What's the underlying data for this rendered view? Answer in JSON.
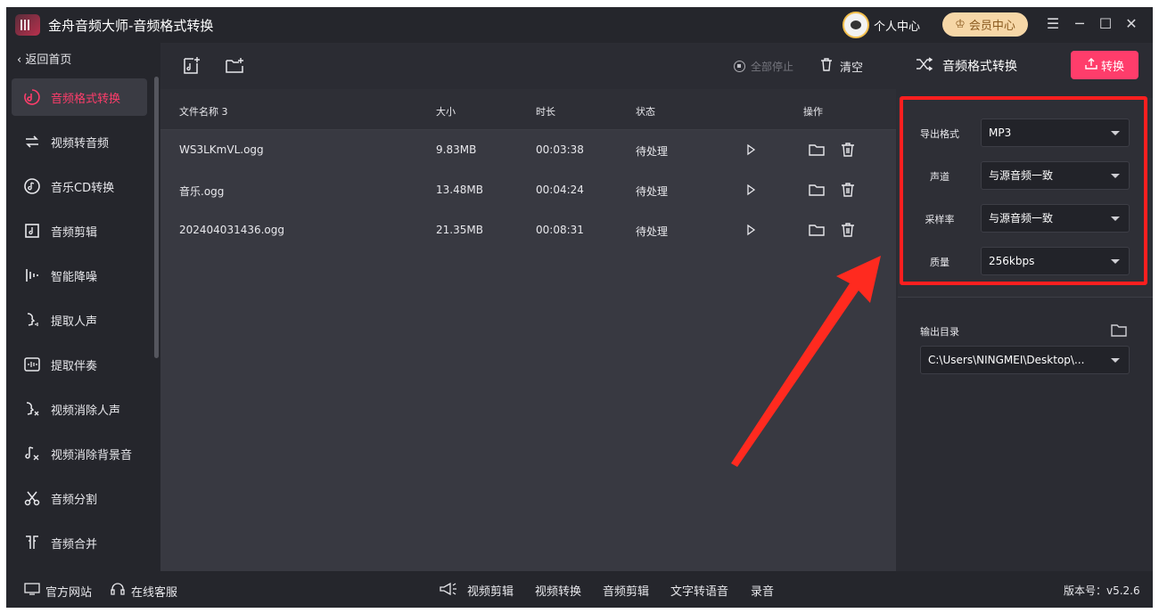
{
  "app": {
    "title": "金舟音频大师-音频格式转换",
    "user_center": "个人中心",
    "vip_center": "会员中心"
  },
  "sidebar": {
    "back": "返回首页",
    "items": [
      {
        "label": "音频格式转换",
        "icon": "audio-convert-icon",
        "active": true
      },
      {
        "label": "视频转音频",
        "icon": "video-to-audio-icon"
      },
      {
        "label": "音乐CD转换",
        "icon": "cd-icon"
      },
      {
        "label": "音频剪辑",
        "icon": "audio-cut-icon"
      },
      {
        "label": "智能降噪",
        "icon": "denoise-icon"
      },
      {
        "label": "提取人声",
        "icon": "vocal-icon"
      },
      {
        "label": "提取伴奏",
        "icon": "accompaniment-icon"
      },
      {
        "label": "视频消除人声",
        "icon": "remove-vocal-icon"
      },
      {
        "label": "视频消除背景音",
        "icon": "remove-bgm-icon"
      },
      {
        "label": "音频分割",
        "icon": "scissors-icon"
      },
      {
        "label": "音频合并",
        "icon": "merge-icon"
      }
    ]
  },
  "toolbar": {
    "stop_all": "全部停止",
    "clear": "清空"
  },
  "table": {
    "headers": {
      "name": "文件名称 3",
      "size": "大小",
      "duration": "时长",
      "status": "状态",
      "actions": "操作"
    },
    "rows": [
      {
        "name": "WS3LKmVL.ogg",
        "size": "9.83MB",
        "duration": "00:03:38",
        "status": "待处理"
      },
      {
        "name": "音乐.ogg",
        "size": "13.48MB",
        "duration": "00:04:24",
        "status": "待处理"
      },
      {
        "name": "202404031436.ogg",
        "size": "21.35MB",
        "duration": "00:08:31",
        "status": "待处理"
      }
    ]
  },
  "panel": {
    "title": "音频格式转换",
    "convert": "转换",
    "settings": [
      {
        "label": "导出格式",
        "value": "MP3"
      },
      {
        "label": "声道",
        "value": "与源音频一致"
      },
      {
        "label": "采样率",
        "value": "与源音频一致"
      },
      {
        "label": "质量",
        "value": "256kbps"
      }
    ],
    "output_label": "输出目录",
    "output_path": "C:\\Users\\NINGMEI\\Desktop\\..."
  },
  "bottom": {
    "website": "官方网站",
    "service": "在线客服",
    "links": [
      "视频剪辑",
      "视频转换",
      "音频剪辑",
      "文字转语音",
      "录音"
    ],
    "version": "版本号：v5.2.6"
  },
  "colors": {
    "accent": "#ff3d6b",
    "highlight": "#ff1f1f"
  }
}
